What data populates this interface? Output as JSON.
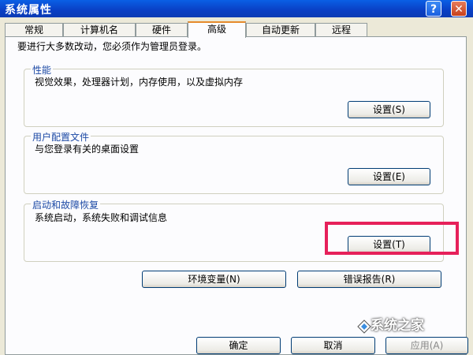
{
  "window": {
    "title": "系统属性",
    "help_label": "?",
    "close_label": "✕"
  },
  "tabs": [
    {
      "label": "常规",
      "active": false
    },
    {
      "label": "计算机名",
      "active": false
    },
    {
      "label": "硬件",
      "active": false
    },
    {
      "label": "高级",
      "active": true
    },
    {
      "label": "自动更新",
      "active": false
    },
    {
      "label": "远程",
      "active": false
    }
  ],
  "advanced": {
    "admin_notice": "要进行大多数改动，您必须作为管理员登录。",
    "performance": {
      "title": "性能",
      "description": "视觉效果，处理器计划，内存使用，以及虚拟内存",
      "settings_button": "设置(S)"
    },
    "user_profiles": {
      "title": "用户配置文件",
      "description": "与您登录有关的桌面设置",
      "settings_button": "设置(E)"
    },
    "startup_recovery": {
      "title": "启动和故障恢复",
      "description": "系统启动，系统失败和调试信息",
      "settings_button": "设置(T)"
    },
    "env_vars_button": "环境变量(N)",
    "error_report_button": "错误报告(R)"
  },
  "footer": {
    "ok_button": "确定",
    "cancel_button": "取消",
    "apply_button": "应用(A)"
  },
  "watermark": {
    "text": "系统之家"
  },
  "colors": {
    "title_bar": "#0a3fc4",
    "highlight_box": "#e6205a",
    "group_label": "#1d4aa5"
  }
}
